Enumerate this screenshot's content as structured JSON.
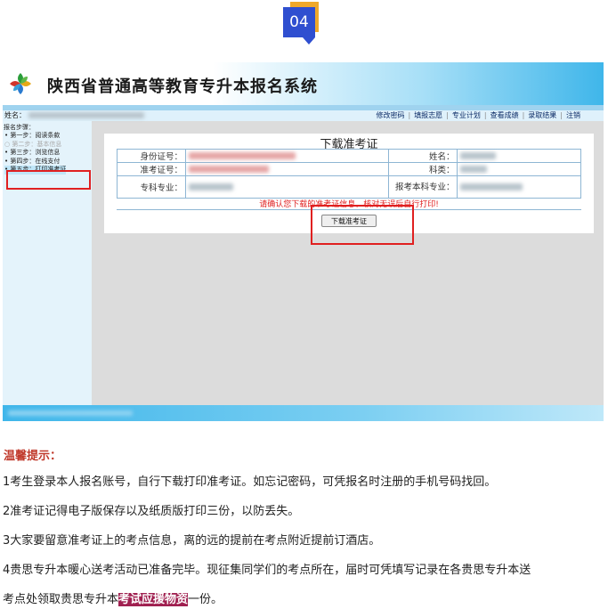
{
  "badge": {
    "number": "04"
  },
  "system": {
    "title": "陕西省普通高等教育专升本报名系统",
    "user_label": "姓名：",
    "nav_links": [
      "修改密码",
      "填报志愿",
      "专业计划",
      "查看成绩",
      "录取结果",
      "注销"
    ]
  },
  "sidebar": {
    "heading": "报名步骤：",
    "steps": [
      "第一步：阅读条款",
      "第二步：基本信息",
      "第三步：浏览信息",
      "第四步：在线支付",
      "第五步：打印准考证"
    ]
  },
  "admission_panel": {
    "title": "下载准考证",
    "fields": {
      "id_label": "身份证号：",
      "name_label": "姓名：",
      "ticket_label": "准考证号：",
      "category_label": "科类：",
      "major_label": "专科专业：",
      "target_major_label": "报考本科专业："
    },
    "warning": "请确认您下载的准考证信息，核对无误后自行打印!",
    "download_button": "下载准考证"
  },
  "footer": {
    "text": "系统版本  服务器 IP 192.168.1.1"
  },
  "tips": {
    "title": "温馨提示：",
    "items": [
      "1考生登录本人报名账号，自行下载打印准考证。如忘记密码，可凭报名时注册的手机号码找回。",
      "2准考证记得电子版保存以及纸质版打印三份，以防丢失。",
      "3大家要留意准考证上的考点信息，离的远的提前在考点附近提前订酒店。",
      "4贵思专升本暖心送考活动已准备完毕。现征集同学们的考点所在，届时可凭填写记录在各贵思专升本送"
    ],
    "item5_before": "考点处领取贵思专升本",
    "item5_highlight": "考试应援物资",
    "item5_after": "一份。"
  },
  "colors": {
    "accent_blue": "#2f4fd0",
    "badge_orange": "#f0a82a",
    "warning_red": "#e02020",
    "tips_title": "#c0392b",
    "highlight": "#a02050"
  }
}
